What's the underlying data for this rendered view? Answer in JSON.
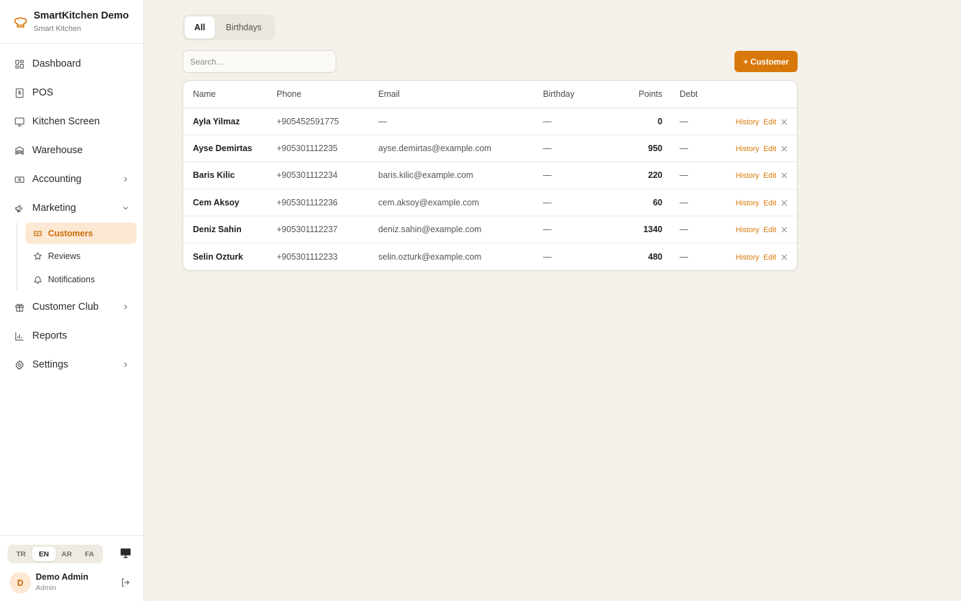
{
  "brand": {
    "title": "SmartKitchen Demo",
    "subtitle": "Smart Kitchen",
    "icon": "chef-hat-icon",
    "accent": "#d9780a"
  },
  "sidebar": {
    "items": [
      {
        "label": "Dashboard",
        "icon": "dashboard-icon"
      },
      {
        "label": "POS",
        "icon": "receipt-icon"
      },
      {
        "label": "Kitchen Screen",
        "icon": "monitor-icon"
      },
      {
        "label": "Warehouse",
        "icon": "warehouse-icon"
      },
      {
        "label": "Accounting",
        "icon": "banknote-icon",
        "expandable": true
      },
      {
        "label": "Marketing",
        "icon": "megaphone-icon",
        "expanded": true
      },
      {
        "label": "Customer Club",
        "icon": "gift-icon",
        "expandable": true
      },
      {
        "label": "Reports",
        "icon": "chart-icon"
      },
      {
        "label": "Settings",
        "icon": "gear-icon",
        "expandable": true
      }
    ],
    "marketing_sub": [
      {
        "label": "Customers",
        "icon": "ticket-icon",
        "active": true
      },
      {
        "label": "Reviews",
        "icon": "star-icon"
      },
      {
        "label": "Notifications",
        "icon": "bell-icon"
      }
    ]
  },
  "footer": {
    "languages": [
      "TR",
      "EN",
      "AR",
      "FA"
    ],
    "active_language": "EN",
    "user": {
      "initial": "D",
      "name": "Demo Admin",
      "role": "Admin"
    }
  },
  "tabs": [
    {
      "label": "All",
      "active": true
    },
    {
      "label": "Birthdays"
    }
  ],
  "search": {
    "placeholder": "Search..."
  },
  "add_button": {
    "label": "+ Customer"
  },
  "table": {
    "headers": {
      "name": "Name",
      "phone": "Phone",
      "email": "Email",
      "birthday": "Birthday",
      "points": "Points",
      "debt": "Debt"
    },
    "actions": {
      "history": "History",
      "edit": "Edit"
    },
    "rows": [
      {
        "name": "Ayla Yilmaz",
        "phone": "+905452591775",
        "email": "—",
        "birthday": "—",
        "points": "0",
        "debt": "—"
      },
      {
        "name": "Ayse Demirtas",
        "phone": "+905301112235",
        "email": "ayse.demirtas@example.com",
        "birthday": "—",
        "points": "950",
        "debt": "—"
      },
      {
        "name": "Baris Kilic",
        "phone": "+905301112234",
        "email": "baris.kilic@example.com",
        "birthday": "—",
        "points": "220",
        "debt": "—"
      },
      {
        "name": "Cem Aksoy",
        "phone": "+905301112236",
        "email": "cem.aksoy@example.com",
        "birthday": "—",
        "points": "60",
        "debt": "—"
      },
      {
        "name": "Deniz Sahin",
        "phone": "+905301112237",
        "email": "deniz.sahin@example.com",
        "birthday": "—",
        "points": "1340",
        "debt": "—"
      },
      {
        "name": "Selin Ozturk",
        "phone": "+905301112233",
        "email": "selin.ozturk@example.com",
        "birthday": "—",
        "points": "480",
        "debt": "—"
      }
    ]
  }
}
